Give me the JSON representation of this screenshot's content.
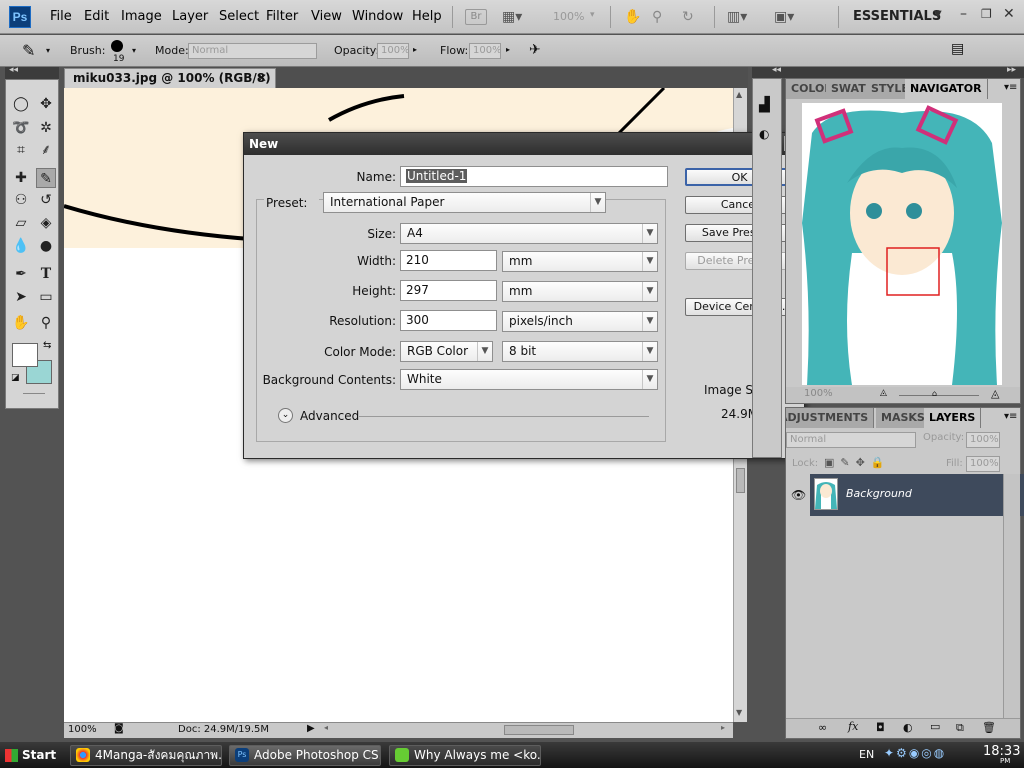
{
  "app": {
    "logo": "Ps",
    "menu": [
      "File",
      "Edit",
      "Image",
      "Layer",
      "Select",
      "Filter",
      "View",
      "Window",
      "Help"
    ],
    "bridge_label": "Br",
    "zoom_level": "100%",
    "workspace": "ESSENTIALS"
  },
  "options": {
    "brush_label": "Brush:",
    "brush_size": "19",
    "mode_label": "Mode:",
    "mode_value": "Normal",
    "opacity_label": "Opacity:",
    "opacity_value": "100%",
    "flow_label": "Flow:",
    "flow_value": "100%"
  },
  "document": {
    "tab_title": "miku033.jpg @ 100% (RGB/8) *",
    "zoom": "100%",
    "doc_info": "Doc: 24.9M/19.5M"
  },
  "dialog": {
    "title": "New",
    "name_label": "Name:",
    "name_value": "Untitled-1",
    "preset_label": "Preset:",
    "preset_value": "International Paper",
    "size_label": "Size:",
    "size_value": "A4",
    "width_label": "Width:",
    "width_value": "210",
    "width_unit": "mm",
    "height_label": "Height:",
    "height_value": "297",
    "height_unit": "mm",
    "resolution_label": "Resolution:",
    "resolution_value": "300",
    "resolution_unit": "pixels/inch",
    "colormode_label": "Color Mode:",
    "colormode_value": "RGB Color",
    "bitdepth_value": "8 bit",
    "bg_label": "Background Contents:",
    "bg_value": "White",
    "advanced_label": "Advanced",
    "ok": "OK",
    "cancel": "Cancel",
    "save_preset": "Save Preset...",
    "delete_preset": "Delete Preset...",
    "device_central": "Device Central...",
    "image_size_label": "Image Size:",
    "image_size_value": "24.9M"
  },
  "panels": {
    "top_tabs": [
      "COLOR",
      "SWATC",
      "STYLE",
      "NAVIGATOR"
    ],
    "nav_zoom": "100%",
    "bottom_tabs": [
      "ADJUSTMENTS",
      "MASKS",
      "LAYERS"
    ],
    "blend_mode": "Normal",
    "opacity_label": "Opacity:",
    "opacity_value": "100%",
    "lock_label": "Lock:",
    "fill_label": "Fill:",
    "fill_value": "100%",
    "layer_name": "Background"
  },
  "taskbar": {
    "start": "Start",
    "tasks": [
      "4Manga-สังคมคุณภาพ...",
      "Adobe Photoshop CS...",
      "Why Always me   <ko..."
    ],
    "lang": "EN",
    "time": "18:33",
    "ampm": "PM"
  },
  "colors": {
    "accent": "#0b3e7a",
    "hair": "#44b5b8",
    "selection": "#3e4a5c",
    "nav_box": "#e02020"
  }
}
